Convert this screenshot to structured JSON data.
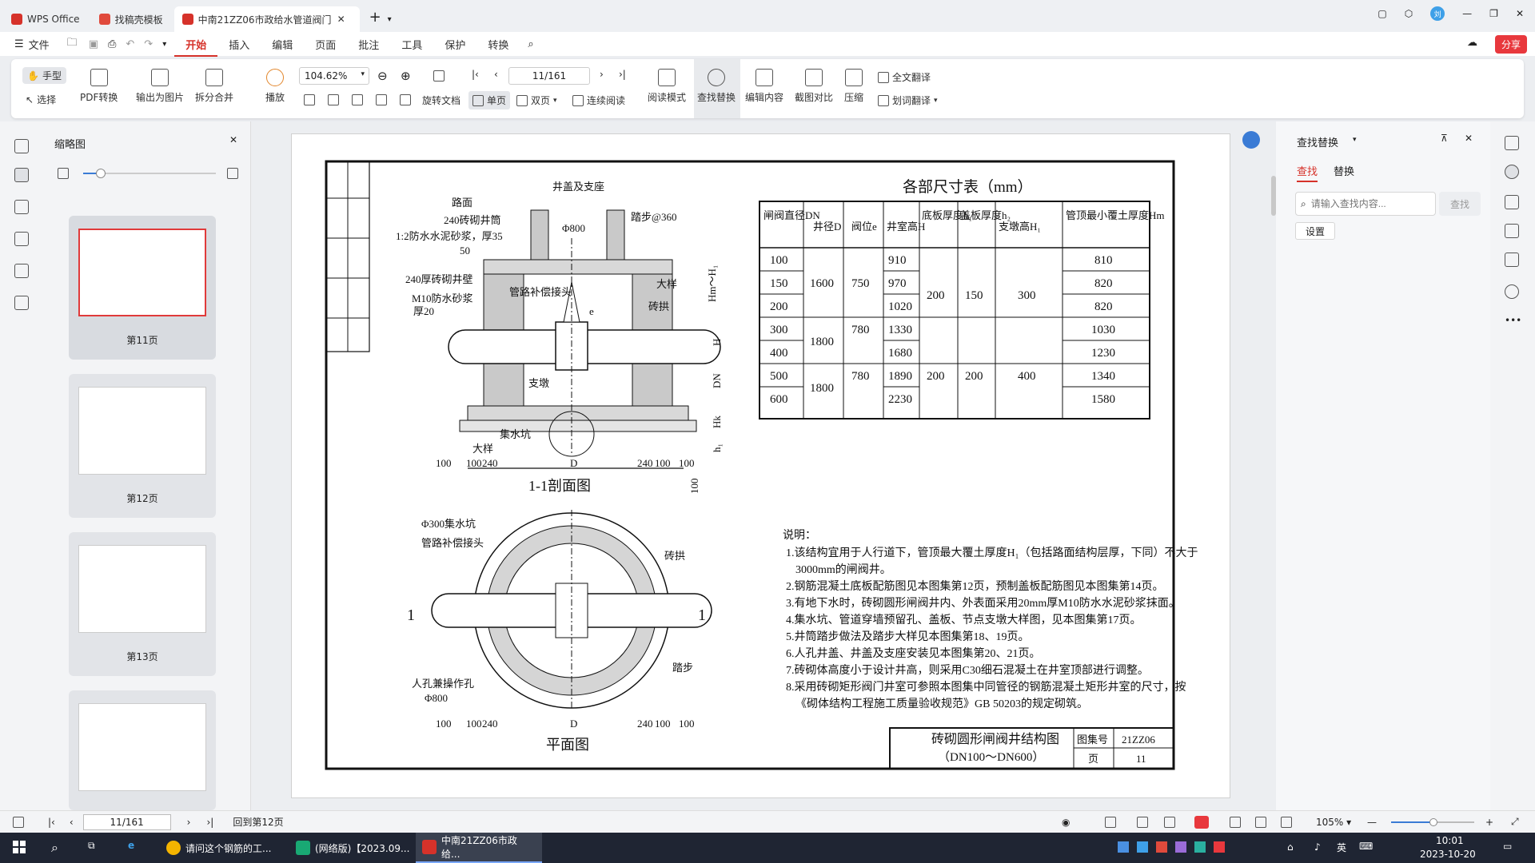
{
  "titlebar": {
    "tabs": [
      {
        "label": "WPS Office"
      },
      {
        "label": "找稿壳模板"
      },
      {
        "label": "中南21ZZ06市政给水管道阀门"
      }
    ],
    "avatar_text": "刘"
  },
  "menubar": {
    "file": "文件",
    "items": [
      "开始",
      "插入",
      "编辑",
      "页面",
      "批注",
      "工具",
      "保护",
      "转换"
    ],
    "share": "分享"
  },
  "toolbar": {
    "hand": "手型",
    "select": "选择",
    "pdf_convert": "PDF转换",
    "export_img": "输出为图片",
    "split_merge": "拆分合并",
    "play": "播放",
    "zoom": "104.62%",
    "page": "11/161",
    "rotate": "旋转文档",
    "single": "单页",
    "double": "双页",
    "continuous": "连续阅读",
    "read_mode": "阅读模式",
    "find_replace": "查找替换",
    "edit_content": "编辑内容",
    "screenshot_compare": "截图对比",
    "compress": "压缩",
    "full_translate": "全文翻译",
    "word_translate": "划词翻译"
  },
  "thumbpanel": {
    "title": "缩略图",
    "pages": [
      "第11页",
      "第12页",
      "第13页"
    ]
  },
  "drawing": {
    "table_title": "各部尺寸表（mm）",
    "headers": [
      "闸阀直径DN",
      "井径D",
      "阀位e",
      "井室高H",
      "底板厚度h₁",
      "盖板厚度h₂",
      "支墩高H₁",
      "管顶最小覆土厚度Hm"
    ],
    "dn": [
      "100",
      "150",
      "200",
      "300",
      "400",
      "500",
      "600"
    ],
    "D": [
      "1600",
      "1800",
      "1800"
    ],
    "e": [
      "750",
      "780",
      "780"
    ],
    "H": [
      "910",
      "970",
      "1020",
      "1330",
      "1680",
      "1890",
      "2230"
    ],
    "h1": [
      "200",
      "200"
    ],
    "h2": [
      "150",
      "200"
    ],
    "H1": [
      "300",
      "400"
    ],
    "Hm": [
      "810",
      "820",
      "820",
      "1030",
      "1230",
      "1340",
      "1580"
    ],
    "section_title": "1-1剖面图",
    "plan_title": "平面图",
    "labels": {
      "road": "路面",
      "cover": "井盖及支座",
      "brick": "240砖砌井筒",
      "mortar": "1:2防水水泥砂浆，厚35",
      "l50": "50",
      "step": "踏步@360",
      "d800": "Φ800",
      "wall": "240厚砖砌井壁",
      "m10": "M10防水砂浆",
      "t20": "厚20",
      "comp": "管路补偿接头",
      "detail": "大样",
      "arch": "砖拱",
      "e": "e",
      "pier": "支墩",
      "sump": "集水坑",
      "sump300": "Φ300集水坑",
      "comp2": "管路补偿接头",
      "arch2": "砖拱",
      "step2": "踏步",
      "manhole": "人孔兼操作孔",
      "d800b": "Φ800",
      "one": "1",
      "D": "D",
      "Hm": "Hm～H₁",
      "Hh": "H",
      "DN": "DN",
      "Hk": "Hk",
      "h1": "h₁",
      "v100": "100"
    },
    "dims": [
      "100",
      "100",
      "240",
      "D",
      "240",
      "100",
      "100"
    ],
    "notes_title": "说明：",
    "notes": [
      "1.该结构宜用于人行道下，管顶最大覆土厚度H₁（包括路面结构层厚，下同）不大于",
      "3000mm的闸阀井。",
      "2.钢筋混凝土底板配筋图见本图集第12页，预制盖板配筋图见本图集第14页。",
      "3.有地下水时，砖砌圆形闸阀井内、外表面采用20mm厚M10防水水泥砂浆抹面。",
      "4.集水坑、管道穿墙预留孔、盖板、节点支墩大样图，见本图集第17页。",
      "5.井筒踏步做法及踏步大样见本图集第18、19页。",
      "6.人孔井盖、井盖及支座安装见本图集第20、21页。",
      "7.砖砌体高度小于设计井高，则采用C30细石混凝土在井室顶部进行调整。",
      "8.采用砖砌矩形阀门井室可参照本图集中同管径的钢筋混凝土矩形井室的尺寸，按",
      "《砌体结构工程施工质量验收规范》GB 50203的规定砌筑。"
    ],
    "title_block": {
      "title": "砖砌圆形闸阀井结构图",
      "sub": "（DN100～DN600）",
      "atlas_label": "图集号",
      "atlas": "21ZZ06",
      "page_label": "页",
      "page": "11"
    }
  },
  "rightpanel": {
    "title": "查找替换",
    "tab_find": "查找",
    "tab_replace": "替换",
    "placeholder": "请输入查找内容...",
    "find_btn": "查找",
    "settings": "设置"
  },
  "statusbar": {
    "page": "11/161",
    "back": "回到第12页",
    "zoom": "105%"
  },
  "taskbar": {
    "tasks": [
      "请问这个钢筋的工...",
      "(网络版)【2023.09...",
      "中南21ZZ06市政给..."
    ],
    "time": "10:01",
    "date": "2023-10-20",
    "lang": "英"
  }
}
